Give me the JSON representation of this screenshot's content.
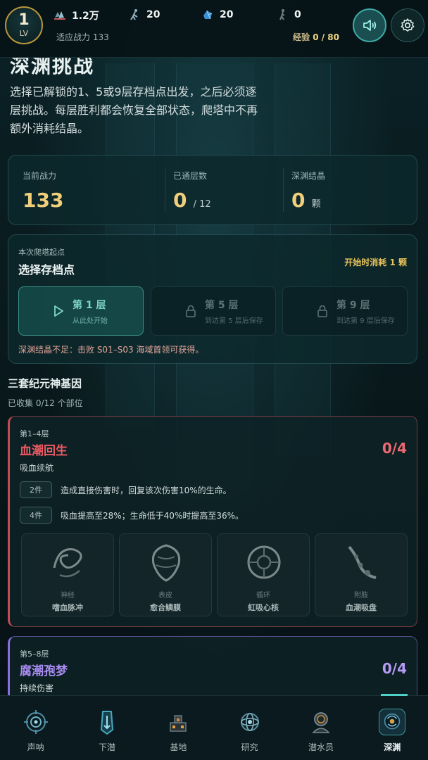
{
  "topbar": {
    "level": "1",
    "level_label": "LV",
    "resources": [
      {
        "icon": "crystal-shards-icon",
        "value": "1.2万"
      },
      {
        "icon": "diver-figure-icon",
        "value": "20"
      },
      {
        "icon": "blue-ore-icon",
        "value": "20"
      },
      {
        "icon": "dark-figure-icon",
        "value": "0"
      }
    ],
    "power_label": "适应战力 133",
    "exp_label": "经验",
    "exp_value": "0 / 80"
  },
  "page": {
    "title": "深渊挑战",
    "description": "选择已解锁的1、5或9层存档点出发，之后必须逐层挑战。每层胜利都会恢复全部状态，爬塔中不再额外消耗结晶。"
  },
  "stats": [
    {
      "label": "当前战力",
      "value": "133",
      "unit": ""
    },
    {
      "label": "已通层数",
      "value": "0",
      "unit": "/ 12"
    },
    {
      "label": "深渊结晶",
      "value": "0",
      "unit": "颗"
    }
  ],
  "start": {
    "subtitle": "本次爬塔起点",
    "title": "选择存档点",
    "cost": "开始时消耗 1 颗",
    "floors": [
      {
        "name": "第 1 层",
        "note": "从此处开始"
      },
      {
        "name": "第 5 层",
        "note": "到达第 5 层后保存"
      },
      {
        "name": "第 9 层",
        "note": "到达第 9 层后保存"
      }
    ],
    "warning": "深渊结晶不足：击败 S01–S03 海域首领可获得。"
  },
  "genes": {
    "title": "三套纪元神基因",
    "collected": "已收集 0/12 个部位",
    "sets": [
      {
        "range": "第1–4层",
        "name": "血潮回生",
        "progress": "0/4",
        "subtitle": "吸血续航",
        "bonus": [
          {
            "tag": "2件",
            "text": "造成直接伤害时，回复该次伤害10%的生命。"
          },
          {
            "tag": "4件",
            "text": "吸血提高至28%；生命低于40%时提高至36%。"
          }
        ],
        "parts": [
          {
            "type": "神经",
            "name": "嗜血脉冲"
          },
          {
            "type": "表皮",
            "name": "愈合鳞膜"
          },
          {
            "type": "循环",
            "name": "虹吸心核"
          },
          {
            "type": "附肢",
            "name": "血潮吸盘"
          }
        ]
      },
      {
        "range": "第5–8层",
        "name": "腐潮孢梦",
        "progress": "0/4",
        "subtitle": "持续伤害"
      }
    ]
  },
  "nav": [
    {
      "label": "声呐",
      "icon": "sonar-icon"
    },
    {
      "label": "下潜",
      "icon": "dive-icon"
    },
    {
      "label": "基地",
      "icon": "base-icon"
    },
    {
      "label": "研究",
      "icon": "research-icon"
    },
    {
      "label": "潜水员",
      "icon": "diver-icon"
    },
    {
      "label": "深渊",
      "icon": "abyss-icon"
    }
  ],
  "colors": {
    "accent": "#3ea8a3",
    "gold": "#f0cf7b",
    "red_set": "#ee5a64",
    "purple_set": "#a98cf2"
  }
}
